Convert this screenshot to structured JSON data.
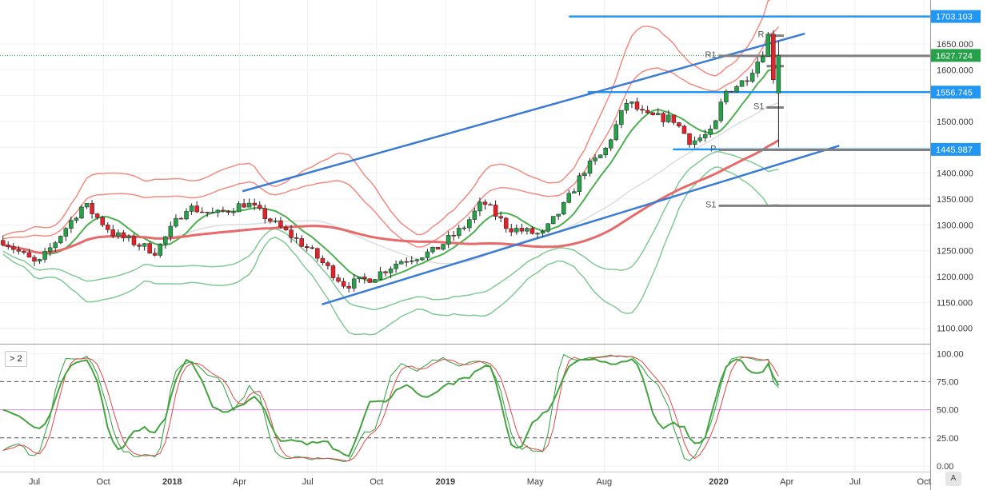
{
  "colors": {
    "bull": "#26a14a",
    "bear": "#e8202a",
    "channel": "#3a7bd5",
    "hline": "#2196f3",
    "pivot": "#808080",
    "bb_upper": "#f28b82",
    "bb_lower": "#81c995",
    "ma_red": "#e8696a",
    "ma_green": "#4caf50",
    "ma_gray": "#dddddd",
    "stoch_k": "#2e9e3e",
    "stoch_d": "#e04848",
    "rsi": "#43a33f"
  },
  "pane_label": "> 2",
  "auto_label": "A",
  "chart_data": {
    "type": "candlestick",
    "instrument_note": "",
    "x_ticks": [
      {
        "label": "Jul",
        "date": "2017-07"
      },
      {
        "label": "Oct",
        "date": "2017-10"
      },
      {
        "label": "2018",
        "date": "2018-01",
        "bold": true
      },
      {
        "label": "Apr",
        "date": "2018-04"
      },
      {
        "label": "Jul",
        "date": "2018-07"
      },
      {
        "label": "Oct",
        "date": "2018-10"
      },
      {
        "label": "2019",
        "date": "2019-01",
        "bold": true
      },
      {
        "label": "May",
        "date": "2019-05"
      },
      {
        "label": "Aug",
        "date": "2019-08"
      },
      {
        "label": "2020",
        "date": "2020-01",
        "bold": true
      },
      {
        "label": "Apr",
        "date": "2020-04"
      },
      {
        "label": "Jul",
        "date": "2020-07"
      },
      {
        "label": "Oct",
        "date": "2020-10"
      }
    ],
    "price_axis": {
      "range": [
        1070,
        1735
      ],
      "ticks": [
        "1100.000",
        "1150.000",
        "1200.000",
        "1250.000",
        "1300.000",
        "1350.000",
        "1400.000",
        "1450.000",
        "1500.000",
        "1550.000",
        "1600.000",
        "1650.000"
      ]
    },
    "price_tags": [
      {
        "label": "1703.103",
        "value": 1703.103,
        "color": "#2196f3"
      },
      {
        "label": "1627.724",
        "value": 1627.724,
        "color": "#26a14a"
      },
      {
        "label": "1556.745",
        "value": 1556.745,
        "color": "#2196f3"
      },
      {
        "label": "1445.987",
        "value": 1445.987,
        "color": "#2196f3"
      }
    ],
    "current_price": 1627.724,
    "horizontal_lines": [
      {
        "value": 1703.103,
        "from": "2019-06-15",
        "to": "2020-10-31"
      },
      {
        "value": 1556.745,
        "from": "2019-07-10",
        "to": "2020-10-31"
      },
      {
        "value": 1445.987,
        "from": "2019-11-01",
        "to": "2020-10-31"
      }
    ],
    "channel_lines": [
      {
        "points": [
          [
            "2018-07-20",
            1146
          ],
          [
            "2020-06-10",
            1453
          ]
        ]
      },
      {
        "points": [
          [
            "2018-04-05",
            1365
          ],
          [
            "2020-04-25",
            1670
          ]
        ]
      }
    ],
    "pivot_levels": [
      {
        "label": "R",
        "value": 1666
      },
      {
        "label": "R1",
        "value": 1627
      },
      {
        "label": "",
        "value": 1607
      },
      {
        "label": "S1",
        "value": 1527
      },
      {
        "label": "P",
        "value": 1445
      },
      {
        "label": "S1",
        "value": 1337
      }
    ],
    "oscillator": {
      "y_range": [
        -5,
        108
      ],
      "ticks": [
        "0.00",
        "25.00",
        "50.00",
        "75.00",
        "100.00"
      ],
      "levels": [
        25,
        50,
        75
      ]
    }
  }
}
